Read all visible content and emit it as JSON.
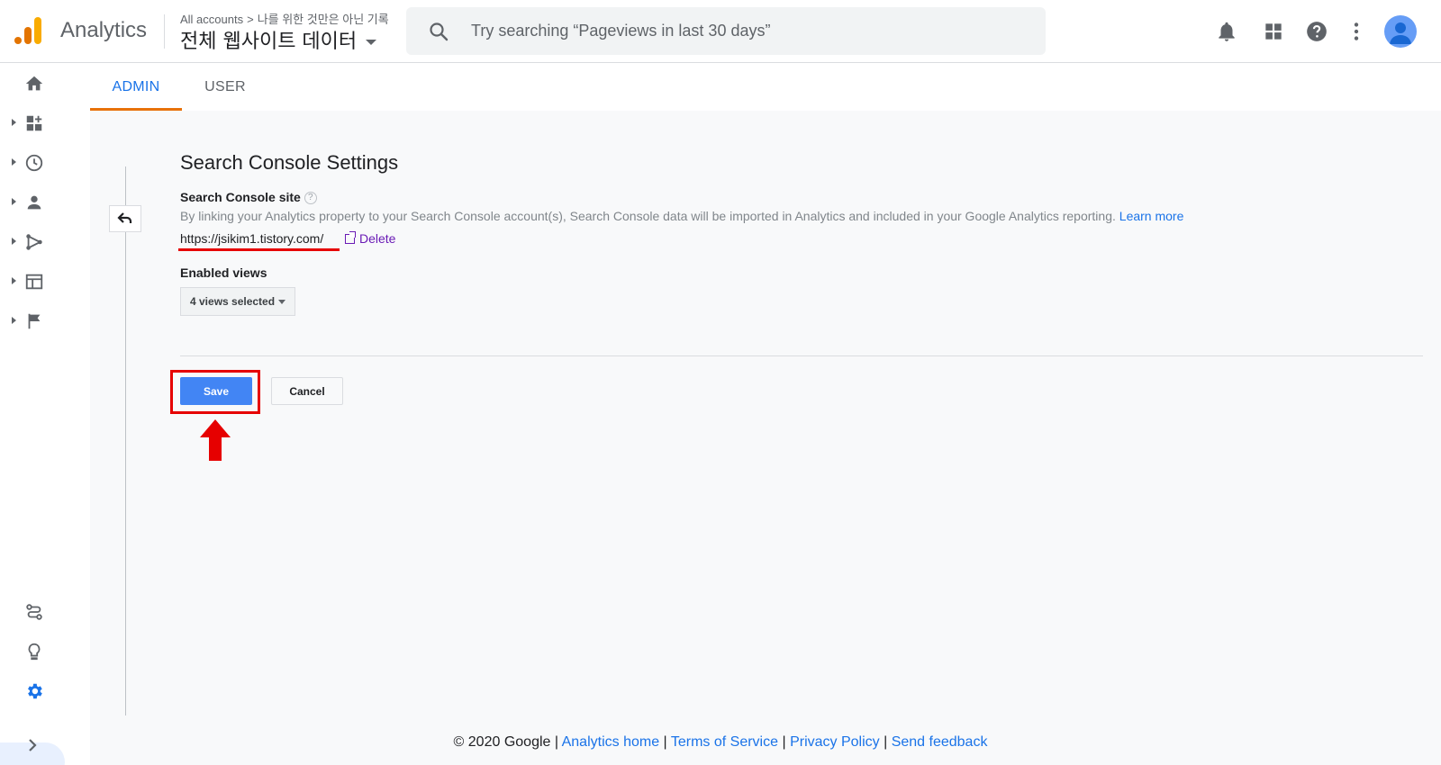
{
  "app": {
    "brand": "Analytics",
    "account_crumb": {
      "all_accounts": "All accounts",
      "separator": ">",
      "property": "나를 위한 것만은 아닌 기록"
    },
    "view_name": "전체 웹사이트 데이터"
  },
  "search": {
    "placeholder": "Try searching “Pageviews in last 30 days”"
  },
  "toolbar": {
    "icons": [
      "bell-icon",
      "apps-grid-icon",
      "help-icon",
      "more-vert-icon",
      "account-avatar"
    ]
  },
  "rail": {
    "items": [
      "home-icon",
      "customization-icon",
      "realtime-icon",
      "audience-icon",
      "acquisition-icon",
      "behavior-icon",
      "conversions-icon",
      "attribution-icon",
      "discover-icon",
      "admin-icon"
    ],
    "active": "admin-icon"
  },
  "tabs": [
    {
      "label": "ADMIN",
      "active": true
    },
    {
      "label": "USER",
      "active": false
    }
  ],
  "settings": {
    "title": "Search Console Settings",
    "site_label": "Search Console site",
    "help": "?",
    "description": "By linking your Analytics property to your Search Console account(s), Search Console data will be imported in Analytics and included in your Google Analytics reporting.",
    "learn_more": "Learn more",
    "site_url": "https://jsikim1.tistory.com/",
    "delete_label": "Delete",
    "enabled_views_label": "Enabled views",
    "enabled_views_value": "4 views selected",
    "save_label": "Save",
    "cancel_label": "Cancel"
  },
  "footer": {
    "copyright": "© 2020 Google",
    "separator": "|",
    "links": [
      "Analytics home",
      "Terms of Service",
      "Privacy Policy",
      "Send feedback"
    ]
  },
  "colors": {
    "accent_blue": "#1a73e8",
    "tab_underline": "#e8710a",
    "annotation_red": "#e60000",
    "save_button": "#4285f4"
  }
}
